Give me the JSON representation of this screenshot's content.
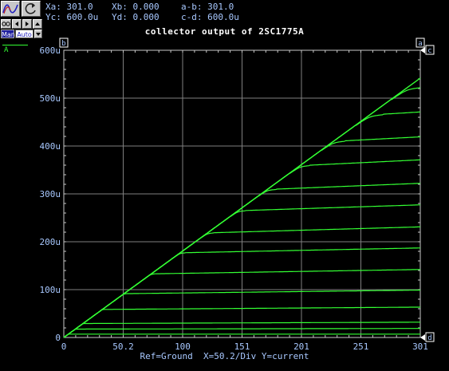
{
  "cursor_readout": {
    "xa": "Xa: 301.0",
    "xb": "Xb: 0.000",
    "ab": "a-b: 301.0",
    "yc": "Yc: 600.0u",
    "yd": "Yd: 0.000",
    "cd": "c-d: 600.0u"
  },
  "toolbar": {
    "man_label": "Man",
    "auto_label": "Auto"
  },
  "trace_legend": "A",
  "chart_data": {
    "type": "line",
    "title": "collector output of 2SC1775A",
    "footer": "Ref=Ground  X=50.2/Div Y=current",
    "x_ticks": [
      "0",
      "50.2",
      "100",
      "151",
      "201",
      "251",
      "301"
    ],
    "y_ticks": [
      "0",
      "100u",
      "200u",
      "300u",
      "400u",
      "500u",
      "600u"
    ],
    "xlim": [
      0,
      301
    ],
    "ylim": [
      0,
      0.0006
    ],
    "grid": true,
    "cursor_markers": [
      "a",
      "b",
      "c",
      "d"
    ],
    "colors": {
      "trace": "#33ff33",
      "grid": "#808080",
      "text": "#a8c8ff",
      "title": "#ffffff"
    },
    "envelope_slope": 1.8e-06,
    "series": [
      {
        "sat": 7e-06,
        "slope": 0.0
      },
      {
        "sat": 1.75e-05,
        "slope": 4.5e-09
      },
      {
        "sat": 2.9e-05,
        "slope": 1e-08
      },
      {
        "sat": 5.8e-05,
        "slope": 1.8e-08
      },
      {
        "sat": 9e-05,
        "slope": 3e-08
      },
      {
        "sat": 0.00013,
        "slope": 4e-08
      },
      {
        "sat": 0.000172,
        "slope": 5e-08
      },
      {
        "sat": 0.00021,
        "slope": 7e-08
      },
      {
        "sat": 0.000253,
        "slope": 8e-08
      },
      {
        "sat": 0.000292,
        "slope": 1e-07
      },
      {
        "sat": 0.000335,
        "slope": 1.2e-07
      },
      {
        "sat": 0.00038,
        "slope": 1.3e-07
      },
      {
        "sat": 0.000426,
        "slope": 1.5e-07
      },
      {
        "sat": 0.000475,
        "slope": 1.6e-07
      }
    ]
  }
}
